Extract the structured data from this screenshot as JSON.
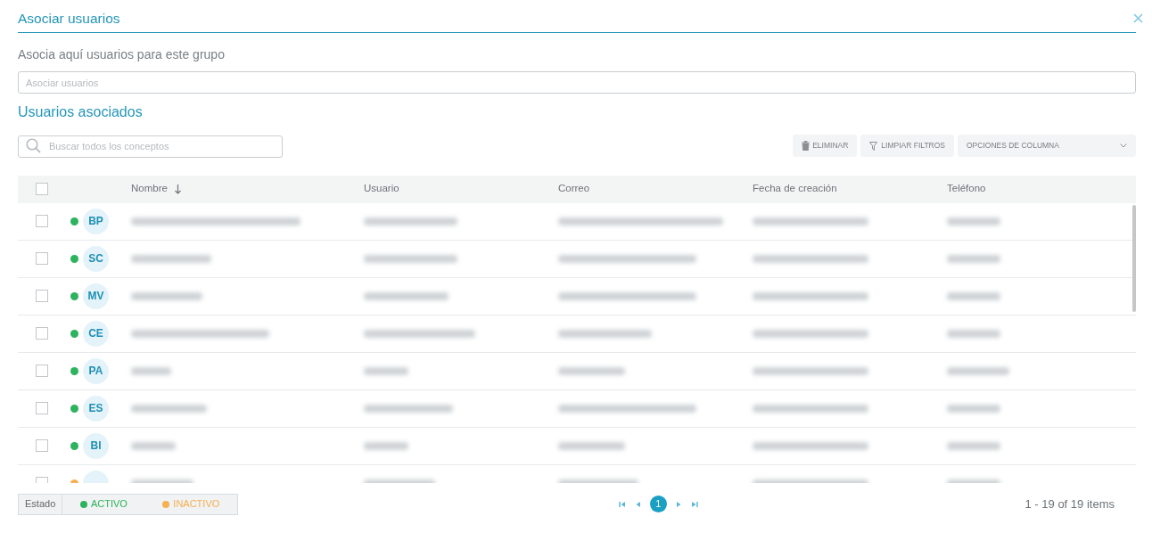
{
  "dialog": {
    "title": "Asociar usuarios"
  },
  "subtitle": "Asocia aquí usuarios para este grupo",
  "associate_field": {
    "placeholder": "Asociar usuarios"
  },
  "section_title": "Usuarios asociados",
  "search": {
    "placeholder": "Buscar todos los conceptos"
  },
  "toolbar": {
    "buttons": [
      {
        "label": "ELIMINAR",
        "kind": "delete"
      },
      {
        "label": "LIMPIAR FILTROS",
        "kind": "filter"
      }
    ],
    "column_options": {
      "label": "OPCIONES DE COLUMNA"
    }
  },
  "table": {
    "select_all": {
      "checked": false
    },
    "columns": [
      {
        "label": "Nombre",
        "sorted": true
      },
      {
        "label": "Usuario",
        "sorted": false
      },
      {
        "label": "Correo",
        "sorted": false
      },
      {
        "label": "Fecha de creación",
        "sorted": false
      },
      {
        "label": "Teléfono",
        "sorted": false
      }
    ],
    "rows": [
      {
        "initials": "BP",
        "color": "#2db35d",
        "checked": false
      },
      {
        "initials": "SC",
        "color": "#2db35d",
        "checked": false
      },
      {
        "initials": "MV",
        "color": "#2db35d",
        "checked": false
      },
      {
        "initials": "CE",
        "color": "#2db35d",
        "checked": false
      },
      {
        "initials": "PA",
        "color": "#2db35d",
        "checked": false
      },
      {
        "initials": "ES",
        "color": "#2db35d",
        "checked": false
      },
      {
        "initials": "BI",
        "color": "#2db35d",
        "checked": false
      },
      {
        "color": "#f5b04f",
        "checked": false
      }
    ]
  },
  "legend": {
    "label": "Estado",
    "items": [
      {
        "label": "ACTIVO",
        "color": "#2db35d"
      },
      {
        "label": "INACTIVO",
        "color": "#f5b04f"
      }
    ]
  },
  "pagination": {
    "pages": [
      {
        "label": "1",
        "selected": true
      }
    ],
    "summary": "1 - 19 of 19 items"
  }
}
